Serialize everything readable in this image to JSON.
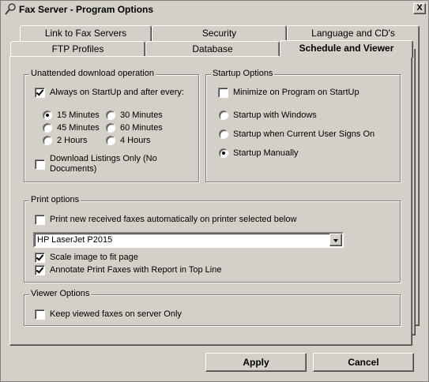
{
  "window": {
    "title": "Fax Server - Program Options",
    "close_glyph": "X"
  },
  "tabs": {
    "row1": [
      "Link to Fax Servers",
      "Security",
      "Language and CD's"
    ],
    "row2": [
      "FTP Profiles",
      "Database",
      "Schedule and Viewer"
    ],
    "active": "Schedule and Viewer"
  },
  "unattended": {
    "legend": "Unattended download operation",
    "always_label": "Always on StartUp and after every:",
    "always_checked": true,
    "intervals": [
      "15 Minutes",
      "30 Minutes",
      "45 Minutes",
      "60 Minutes",
      "2 Hours",
      "4 Hours"
    ],
    "selected_interval": "15 Minutes",
    "listings_only_label": "Download Listings Only (No Documents)",
    "listings_only_checked": false
  },
  "startup": {
    "legend": "Startup Options",
    "minimize_label": "Minimize on Program on StartUp",
    "minimize_checked": false,
    "options": [
      "Startup with Windows",
      "Startup when Current User Signs On",
      "Startup Manually"
    ],
    "selected": "Startup Manually"
  },
  "print": {
    "legend": "Print options",
    "auto_print_label": "Print new received faxes automatically on printer selected below",
    "auto_print_checked": false,
    "printer": "HP LaserJet P2015",
    "scale_label": "Scale image to fit page",
    "scale_checked": true,
    "annotate_label": "Annotate Print Faxes with Report in Top Line",
    "annotate_checked": true
  },
  "viewer": {
    "legend": "Viewer Options",
    "keep_label": "Keep viewed faxes on server Only",
    "keep_checked": false
  },
  "buttons": {
    "apply": "Apply",
    "cancel": "Cancel"
  }
}
